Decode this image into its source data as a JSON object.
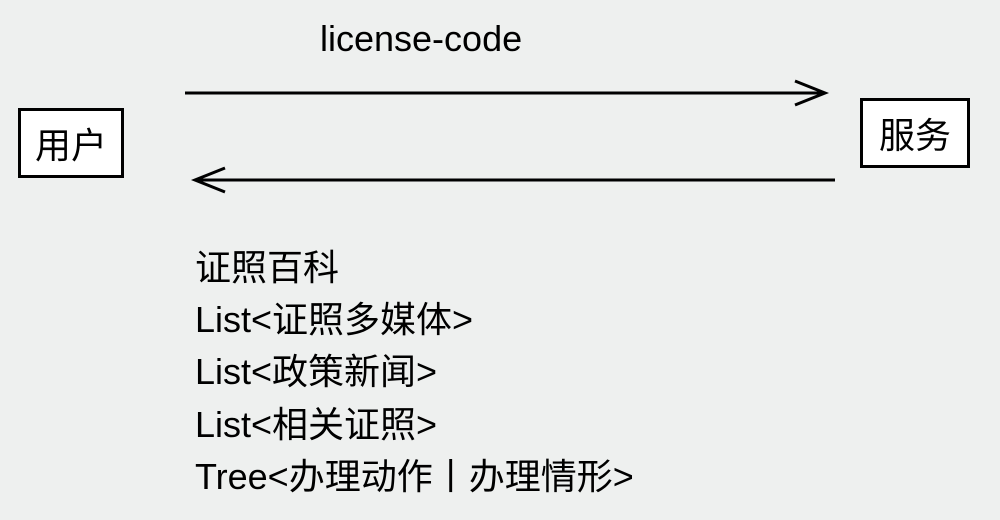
{
  "diagram": {
    "left_box": "用户",
    "right_box": "服务",
    "request_label": "license-code",
    "response_items": [
      "证照百科",
      "List<证照多媒体>",
      "List<政策新闻>",
      "List<相关证照>",
      "Tree<办理动作丨办理情形>"
    ]
  }
}
